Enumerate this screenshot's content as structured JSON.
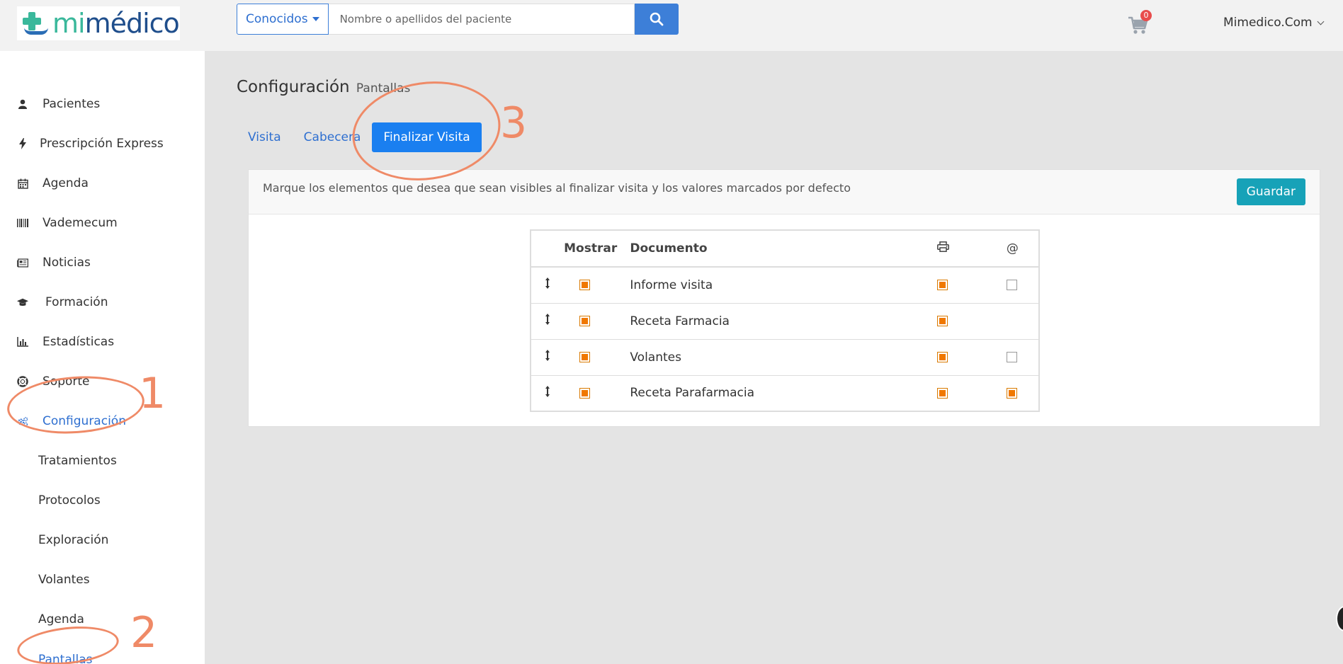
{
  "brand": {
    "mi": "mi",
    "medico": "médico"
  },
  "search": {
    "dropdown_label": "Conocidos",
    "placeholder": "Nombre o apellidos del paciente",
    "value": ""
  },
  "cart": {
    "count": "0"
  },
  "user": {
    "name": "Mimedico.Com"
  },
  "sidebar": {
    "items": [
      {
        "label": "Pacientes",
        "icon": "user-icon"
      },
      {
        "label": "Prescripción Express",
        "icon": "bolt-icon"
      },
      {
        "label": "Agenda",
        "icon": "calendar-icon"
      },
      {
        "label": "Vademecum",
        "icon": "barcode-icon"
      },
      {
        "label": "Noticias",
        "icon": "newspaper-icon"
      },
      {
        "label": "Formación",
        "icon": "graduation-cap-icon"
      },
      {
        "label": "Estadísticas",
        "icon": "bar-chart-icon"
      },
      {
        "label": "Soporte",
        "icon": "lifebuoy-icon"
      },
      {
        "label": "Configuración",
        "icon": "gears-icon"
      }
    ],
    "subitems": [
      {
        "label": "Tratamientos"
      },
      {
        "label": "Protocolos"
      },
      {
        "label": "Exploración"
      },
      {
        "label": "Volantes"
      },
      {
        "label": "Agenda"
      },
      {
        "label": "Pantallas"
      }
    ]
  },
  "page": {
    "title": "Configuración",
    "subtitle": "Pantallas"
  },
  "tabs": [
    {
      "label": "Visita"
    },
    {
      "label": "Cabecera"
    },
    {
      "label": "Finalizar Visita",
      "active": true
    }
  ],
  "panel": {
    "message": "Marque los elementos que desea que sean visibles al finalizar visita y los valores marcados por defecto",
    "save_label": "Guardar"
  },
  "table": {
    "headers": {
      "show": "Mostrar",
      "document": "Documento",
      "print_icon": "printer-icon",
      "mail": "@"
    },
    "rows": [
      {
        "document": "Informe visita",
        "show": true,
        "print": true,
        "mail": false
      },
      {
        "document": "Receta Farmacia",
        "show": true,
        "print": true,
        "mail": null
      },
      {
        "document": "Volantes",
        "show": true,
        "print": true,
        "mail": false
      },
      {
        "document": "Receta Parafarmacia",
        "show": true,
        "print": true,
        "mail": true
      }
    ]
  },
  "annotations": {
    "one": "1",
    "two": "2",
    "three": "3"
  },
  "colors": {
    "accent": "#2e6fd0",
    "primary_button": "#1a7ff0",
    "save_button": "#17a2b8",
    "annotation": "#ef8a67",
    "checkbox_on": "#f07800"
  }
}
